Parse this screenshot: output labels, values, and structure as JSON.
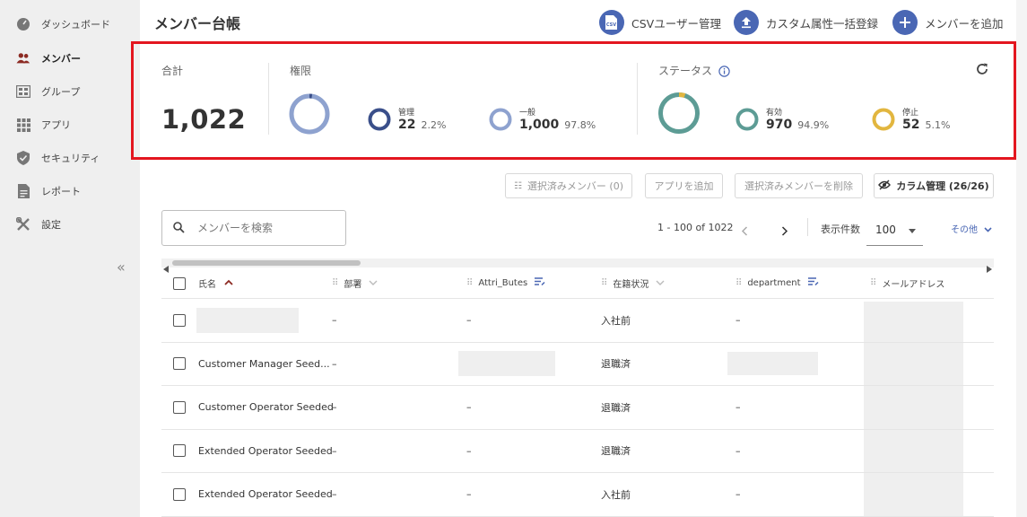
{
  "sidebar": {
    "items": [
      {
        "label": "ダッシュボード",
        "icon": "dashboard-icon"
      },
      {
        "label": "メンバー",
        "icon": "members-icon",
        "active": true
      },
      {
        "label": "グループ",
        "icon": "group-icon"
      },
      {
        "label": "アプリ",
        "icon": "apps-icon"
      },
      {
        "label": "セキュリティ",
        "icon": "shield-icon"
      },
      {
        "label": "レポート",
        "icon": "report-icon"
      },
      {
        "label": "設定",
        "icon": "settings-icon"
      }
    ],
    "collapse": "«"
  },
  "header": {
    "title": "メンバー台帳",
    "csv_label": "CSVユーザー管理",
    "custom_attr_label": "カスタム属性一括登録",
    "add_member_label": "メンバーを追加"
  },
  "stats": {
    "total_label": "合計",
    "total_value": "1,022",
    "role_label": "権限",
    "role_admin": {
      "label": "管理",
      "value": "22",
      "pct": "2.2%"
    },
    "role_general": {
      "label": "一般",
      "value": "1,000",
      "pct": "97.8%"
    },
    "status_label": "ステータス",
    "status_active": {
      "label": "有効",
      "value": "970",
      "pct": "94.9%"
    },
    "status_stopped": {
      "label": "停止",
      "value": "52",
      "pct": "5.1%"
    }
  },
  "toolbar": {
    "selected_members": "選択済みメンバー (0)",
    "add_app": "アプリを追加",
    "delete_selected": "選択済みメンバーを削除",
    "column_manage": "カラム管理 (26/26)"
  },
  "search": {
    "placeholder": "メンバーを検索"
  },
  "pagination": {
    "range": "1 - 100 of 1022",
    "per_page_label": "表示件数",
    "per_page_value": "100",
    "other": "その他"
  },
  "table": {
    "headers": [
      "氏名",
      "部署",
      "Attri_Butes",
      "在籍状況",
      "department",
      "メールアドレス"
    ],
    "rows": [
      {
        "name": "",
        "dept": "–",
        "attr": "–",
        "status": "入社前",
        "department": "–"
      },
      {
        "name": "Customer Manager Seed...",
        "dept": "–",
        "attr": "",
        "status": "退職済",
        "department": ""
      },
      {
        "name": "Customer Operator Seeded",
        "dept": "–",
        "attr": "–",
        "status": "退職済",
        "department": "–"
      },
      {
        "name": "Extended Operator Seeded",
        "dept": "–",
        "attr": "–",
        "status": "退職済",
        "department": "–"
      },
      {
        "name": "Extended Operator Seeded",
        "dept": "–",
        "attr": "–",
        "status": "入社前",
        "department": "–"
      }
    ]
  },
  "colors": {
    "accent": "#4a67b4",
    "donut_blue": "#8ea2cf",
    "donut_dark": "#3a4f8a",
    "status_green": "#5d9c95",
    "status_yellow": "#e2b63f",
    "highlight": "#e3161f"
  }
}
